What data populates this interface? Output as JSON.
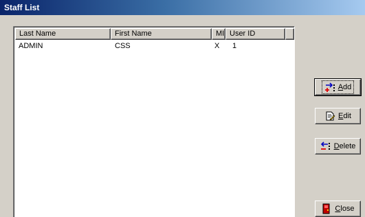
{
  "window": {
    "title": "Staff List"
  },
  "list": {
    "columns": [
      "Last Name",
      "First Name",
      "MI",
      "User ID",
      ""
    ],
    "rows": [
      {
        "last_name": "ADMIN",
        "first_name": "CSS",
        "mi": "X",
        "user_id": "1"
      }
    ]
  },
  "buttons": {
    "add": {
      "mnemonic": "A",
      "rest": "dd",
      "icon": "add-record-icon"
    },
    "edit": {
      "mnemonic": "E",
      "rest": "dit",
      "icon": "edit-record-icon"
    },
    "delete": {
      "mnemonic": "D",
      "rest": "elete",
      "icon": "delete-record-icon"
    },
    "close": {
      "mnemonic": "C",
      "rest": "lose",
      "icon": "exit-door-icon"
    }
  },
  "colors": {
    "title_gradient_start": "#0a246a",
    "title_gradient_end": "#a6caf0",
    "face": "#d4d0c8"
  }
}
